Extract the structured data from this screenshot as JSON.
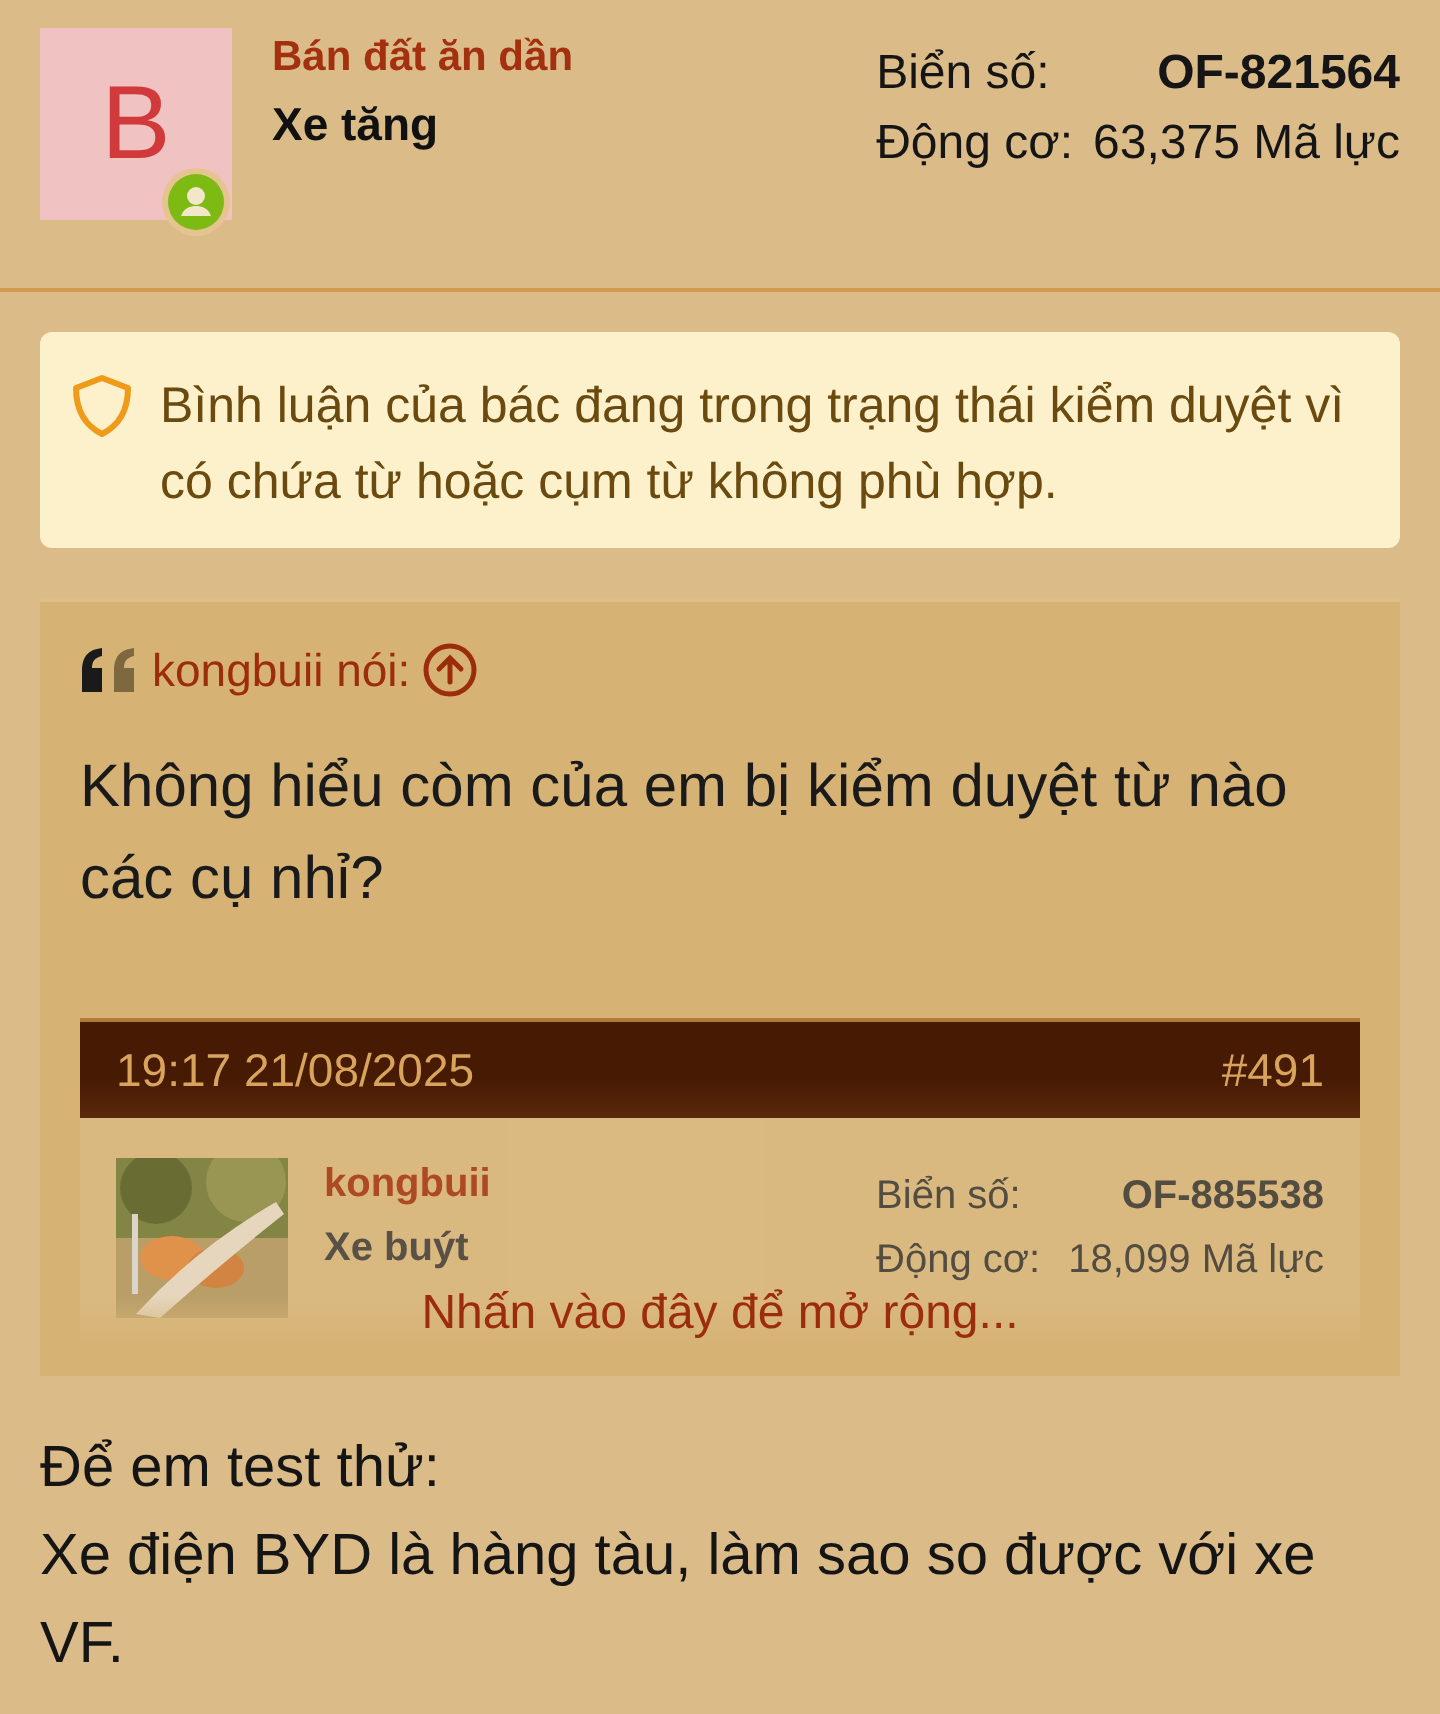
{
  "author": {
    "avatar_letter": "B",
    "online": true,
    "title": "Bán đất ăn dần",
    "name": "Xe tăng",
    "stats": [
      {
        "label": "Biển số:",
        "value": "OF-821564",
        "bold": true
      },
      {
        "label": "Động cơ:",
        "value": "63,375 Mã lực",
        "bold": false
      }
    ]
  },
  "notice": {
    "text": "Bình luận của bác đang trong trạng thái kiểm duyệt vì có chứa từ hoặc cụm từ không phù hợp."
  },
  "quote": {
    "attribution": "kongbuii nói:",
    "text": "Không hiểu còm của em bị kiểm duyệt từ nào các cụ nhỉ?",
    "embedded": {
      "time": "19:17 21/08/2025",
      "number": "#491",
      "title": "kongbuii",
      "name": "Xe buýt",
      "stats": [
        {
          "label": "Biển số:",
          "value": "OF-885538",
          "bold": true
        },
        {
          "label": "Động cơ:",
          "value": "18,099 Mã lực",
          "bold": false
        }
      ]
    },
    "expand_link": "Nhấn vào đây để mở rộng..."
  },
  "body": [
    "Để em test thử:",
    "Xe điện BYD là hàng tàu, làm sao so được với xe VF."
  ]
}
